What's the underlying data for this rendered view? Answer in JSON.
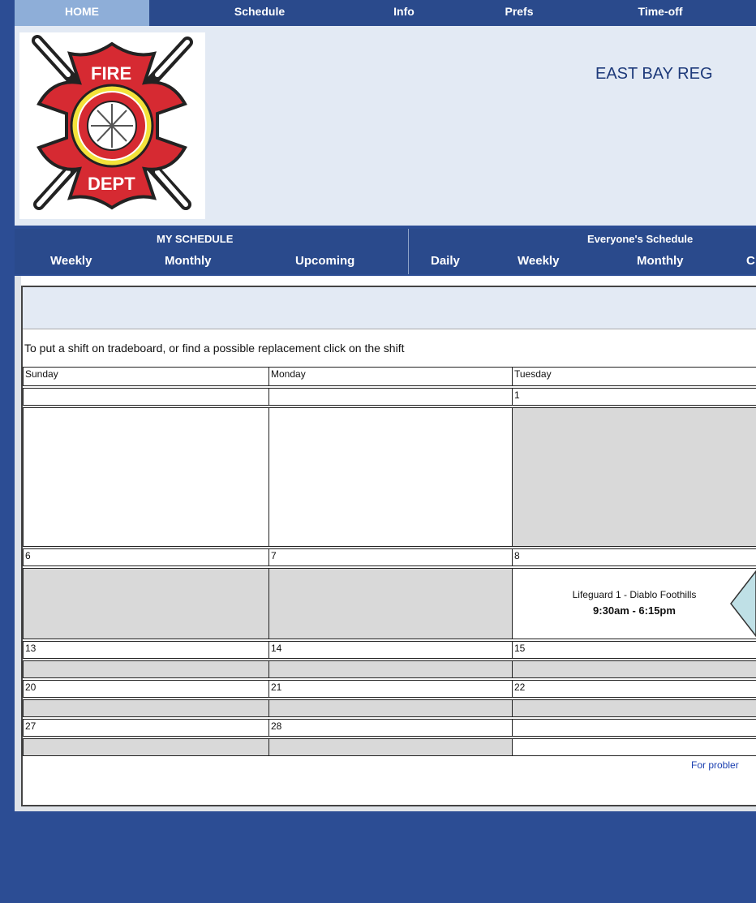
{
  "topnav": {
    "tabs": [
      "HOME",
      "Schedule",
      "Info",
      "Prefs",
      "Time-off"
    ]
  },
  "header": {
    "title": "EAST BAY REG",
    "logo": {
      "top_text": "FIRE",
      "bottom_text": "DEPT"
    }
  },
  "submenu": {
    "my_schedule_label": "MY SCHEDULE",
    "everyone_label": "Everyone's Schedule",
    "my_links": [
      "Weekly",
      "Monthly",
      "Upcoming"
    ],
    "everyone_links": [
      "Daily",
      "Weekly",
      "Monthly",
      "C"
    ]
  },
  "content": {
    "instruction": "To put a shift on tradeboard, or find a possible replacement click on the shift",
    "days": [
      "Sunday",
      "Monday",
      "Tuesday"
    ],
    "dates": {
      "r1": [
        "",
        "",
        "1"
      ],
      "r2": [
        "6",
        "7",
        "8"
      ],
      "r3": [
        "13",
        "14",
        "15"
      ],
      "r4": [
        "20",
        "21",
        "22"
      ],
      "r5": [
        "27",
        "28",
        ""
      ]
    },
    "shift": {
      "name": "Lifeguard 1 - Diablo Foothills",
      "time": "9:30am - 6:15pm"
    },
    "footer_link": "For probler"
  },
  "colors": {
    "nav": "#2a4a8c",
    "home_tab": "#8eaed8",
    "header_bg": "#e3eaf4",
    "gray_cell": "#d9d9d9",
    "arrow_fill": "#bfe0e6"
  }
}
